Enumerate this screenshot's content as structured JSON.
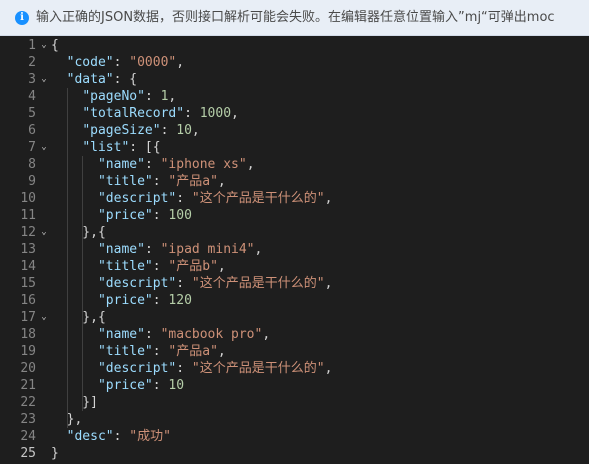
{
  "info_bar": {
    "icon": "i",
    "text": "输入正确的JSON数据，否则接口解析可能会失败。在编辑器任意位置输入”mj“可弹出moc"
  },
  "editor": {
    "lines": [
      {
        "num": "1",
        "fold": "⌄",
        "tokens": [
          {
            "t": "{",
            "c": "p"
          }
        ]
      },
      {
        "num": "2",
        "fold": "",
        "tokens": [
          {
            "t": "  ",
            "c": "p"
          },
          {
            "t": "\"code\"",
            "c": "k"
          },
          {
            "t": ": ",
            "c": "p"
          },
          {
            "t": "\"0000\"",
            "c": "s"
          },
          {
            "t": ",",
            "c": "p"
          }
        ]
      },
      {
        "num": "3",
        "fold": "⌄",
        "tokens": [
          {
            "t": "  ",
            "c": "p"
          },
          {
            "t": "\"data\"",
            "c": "k"
          },
          {
            "t": ": {",
            "c": "p"
          }
        ]
      },
      {
        "num": "4",
        "fold": "",
        "tokens": [
          {
            "t": "    ",
            "c": "p"
          },
          {
            "t": "\"pageNo\"",
            "c": "k"
          },
          {
            "t": ": ",
            "c": "p"
          },
          {
            "t": "1",
            "c": "n"
          },
          {
            "t": ",",
            "c": "p"
          }
        ]
      },
      {
        "num": "5",
        "fold": "",
        "tokens": [
          {
            "t": "    ",
            "c": "p"
          },
          {
            "t": "\"totalRecord\"",
            "c": "k"
          },
          {
            "t": ": ",
            "c": "p"
          },
          {
            "t": "1000",
            "c": "n"
          },
          {
            "t": ",",
            "c": "p"
          }
        ]
      },
      {
        "num": "6",
        "fold": "",
        "tokens": [
          {
            "t": "    ",
            "c": "p"
          },
          {
            "t": "\"pageSize\"",
            "c": "k"
          },
          {
            "t": ": ",
            "c": "p"
          },
          {
            "t": "10",
            "c": "n"
          },
          {
            "t": ",",
            "c": "p"
          }
        ]
      },
      {
        "num": "7",
        "fold": "⌄",
        "tokens": [
          {
            "t": "    ",
            "c": "p"
          },
          {
            "t": "\"list\"",
            "c": "k"
          },
          {
            "t": ": [{",
            "c": "p"
          }
        ]
      },
      {
        "num": "8",
        "fold": "",
        "tokens": [
          {
            "t": "      ",
            "c": "p"
          },
          {
            "t": "\"name\"",
            "c": "k"
          },
          {
            "t": ": ",
            "c": "p"
          },
          {
            "t": "\"iphone xs\"",
            "c": "s"
          },
          {
            "t": ",",
            "c": "p"
          }
        ]
      },
      {
        "num": "9",
        "fold": "",
        "tokens": [
          {
            "t": "      ",
            "c": "p"
          },
          {
            "t": "\"title\"",
            "c": "k"
          },
          {
            "t": ": ",
            "c": "p"
          },
          {
            "t": "\"产品a\"",
            "c": "s"
          },
          {
            "t": ",",
            "c": "p"
          }
        ]
      },
      {
        "num": "10",
        "fold": "",
        "tokens": [
          {
            "t": "      ",
            "c": "p"
          },
          {
            "t": "\"descript\"",
            "c": "k"
          },
          {
            "t": ": ",
            "c": "p"
          },
          {
            "t": "\"这个产品是干什么的\"",
            "c": "s"
          },
          {
            "t": ",",
            "c": "p"
          }
        ]
      },
      {
        "num": "11",
        "fold": "",
        "tokens": [
          {
            "t": "      ",
            "c": "p"
          },
          {
            "t": "\"price\"",
            "c": "k"
          },
          {
            "t": ": ",
            "c": "p"
          },
          {
            "t": "100",
            "c": "n"
          }
        ]
      },
      {
        "num": "12",
        "fold": "⌄",
        "tokens": [
          {
            "t": "    },{",
            "c": "p"
          }
        ]
      },
      {
        "num": "13",
        "fold": "",
        "tokens": [
          {
            "t": "      ",
            "c": "p"
          },
          {
            "t": "\"name\"",
            "c": "k"
          },
          {
            "t": ": ",
            "c": "p"
          },
          {
            "t": "\"ipad mini4\"",
            "c": "s"
          },
          {
            "t": ",",
            "c": "p"
          }
        ]
      },
      {
        "num": "14",
        "fold": "",
        "tokens": [
          {
            "t": "      ",
            "c": "p"
          },
          {
            "t": "\"title\"",
            "c": "k"
          },
          {
            "t": ": ",
            "c": "p"
          },
          {
            "t": "\"产品b\"",
            "c": "s"
          },
          {
            "t": ",",
            "c": "p"
          }
        ]
      },
      {
        "num": "15",
        "fold": "",
        "tokens": [
          {
            "t": "      ",
            "c": "p"
          },
          {
            "t": "\"descript\"",
            "c": "k"
          },
          {
            "t": ": ",
            "c": "p"
          },
          {
            "t": "\"这个产品是干什么的\"",
            "c": "s"
          },
          {
            "t": ",",
            "c": "p"
          }
        ]
      },
      {
        "num": "16",
        "fold": "",
        "tokens": [
          {
            "t": "      ",
            "c": "p"
          },
          {
            "t": "\"price\"",
            "c": "k"
          },
          {
            "t": ": ",
            "c": "p"
          },
          {
            "t": "120",
            "c": "n"
          }
        ]
      },
      {
        "num": "17",
        "fold": "⌄",
        "tokens": [
          {
            "t": "    },{",
            "c": "p"
          }
        ]
      },
      {
        "num": "18",
        "fold": "",
        "tokens": [
          {
            "t": "      ",
            "c": "p"
          },
          {
            "t": "\"name\"",
            "c": "k"
          },
          {
            "t": ": ",
            "c": "p"
          },
          {
            "t": "\"macbook pro\"",
            "c": "s"
          },
          {
            "t": ",",
            "c": "p"
          }
        ]
      },
      {
        "num": "19",
        "fold": "",
        "tokens": [
          {
            "t": "      ",
            "c": "p"
          },
          {
            "t": "\"title\"",
            "c": "k"
          },
          {
            "t": ": ",
            "c": "p"
          },
          {
            "t": "\"产品a\"",
            "c": "s"
          },
          {
            "t": ",",
            "c": "p"
          }
        ]
      },
      {
        "num": "20",
        "fold": "",
        "tokens": [
          {
            "t": "      ",
            "c": "p"
          },
          {
            "t": "\"descript\"",
            "c": "k"
          },
          {
            "t": ": ",
            "c": "p"
          },
          {
            "t": "\"这个产品是干什么的\"",
            "c": "s"
          },
          {
            "t": ",",
            "c": "p"
          }
        ]
      },
      {
        "num": "21",
        "fold": "",
        "tokens": [
          {
            "t": "      ",
            "c": "p"
          },
          {
            "t": "\"price\"",
            "c": "k"
          },
          {
            "t": ": ",
            "c": "p"
          },
          {
            "t": "10",
            "c": "n"
          }
        ]
      },
      {
        "num": "22",
        "fold": "",
        "tokens": [
          {
            "t": "    }]",
            "c": "p"
          }
        ]
      },
      {
        "num": "23",
        "fold": "",
        "tokens": [
          {
            "t": "  },",
            "c": "p"
          }
        ]
      },
      {
        "num": "24",
        "fold": "",
        "tokens": [
          {
            "t": "  ",
            "c": "p"
          },
          {
            "t": "\"desc\"",
            "c": "k"
          },
          {
            "t": ": ",
            "c": "p"
          },
          {
            "t": "\"成功\"",
            "c": "s"
          }
        ]
      },
      {
        "num": "25",
        "fold": "",
        "tokens": [
          {
            "t": "}",
            "c": "p"
          }
        ]
      }
    ]
  },
  "colors": {
    "background": "#1e1e1e",
    "key": "#9cdcfe",
    "string": "#ce9178",
    "number": "#b5cea8",
    "punctuation": "#d4d4d4",
    "line_number": "#858585",
    "info_bar": "#e8eef6",
    "info_icon": "#1890ff"
  }
}
